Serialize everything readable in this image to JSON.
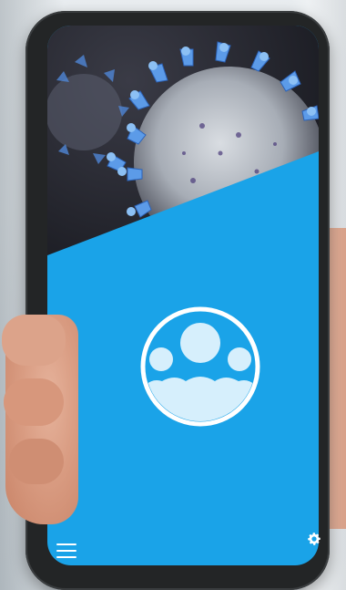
{
  "app": {
    "logo": "community-group-icon",
    "hero_image": "coronavirus-illustration",
    "colors": {
      "accent": "#1aa3e8",
      "logo_fill": "#d6effc",
      "white": "#ffffff"
    }
  },
  "toolbar": {
    "menu_icon": "hamburger-menu-icon",
    "settings_icon": "gear-icon"
  }
}
